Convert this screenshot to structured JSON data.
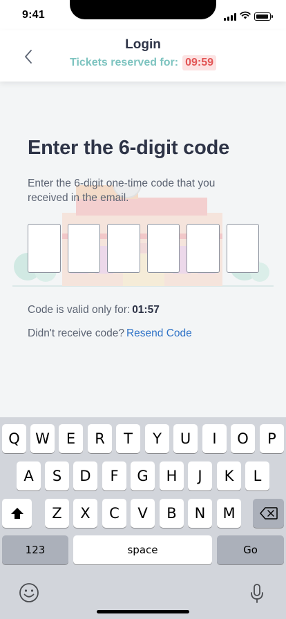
{
  "status_bar": {
    "time": "9:41",
    "icons": [
      "signal-icon",
      "wifi-icon",
      "battery-icon"
    ]
  },
  "header": {
    "title": "Login",
    "reserved_label": "Tickets reserved for:",
    "reserved_timer": "09:59",
    "back_icon": "chevron-left-icon"
  },
  "main": {
    "heading": "Enter the 6-digit code",
    "description": "Enter the 6-digit one-time code that you received in the email.",
    "code_digits": [
      "",
      "",
      "",
      "",
      "",
      ""
    ],
    "validity_label": "Code is valid only for:",
    "validity_timer": "01:57",
    "resend_prompt": "Didn't receive code?",
    "resend_link": "Resend Code"
  },
  "keyboard": {
    "row1": [
      "Q",
      "W",
      "E",
      "R",
      "T",
      "Y",
      "U",
      "I",
      "O",
      "P"
    ],
    "row2": [
      "A",
      "S",
      "D",
      "F",
      "G",
      "H",
      "J",
      "K",
      "L"
    ],
    "row3": [
      "Z",
      "X",
      "C",
      "V",
      "B",
      "N",
      "M"
    ],
    "numbers_key": "123",
    "space_key": "space",
    "go_key": "Go",
    "shift_icon": "shift-icon",
    "delete_icon": "backspace-icon",
    "emoji_icon": "emoji-icon",
    "mic_icon": "microphone-icon"
  },
  "colors": {
    "accent_teal": "#7ec4c0",
    "timer_red": "#e25555",
    "timer_bg": "#fce3e3",
    "link_blue": "#2f73c7",
    "heading": "#2e3447"
  }
}
